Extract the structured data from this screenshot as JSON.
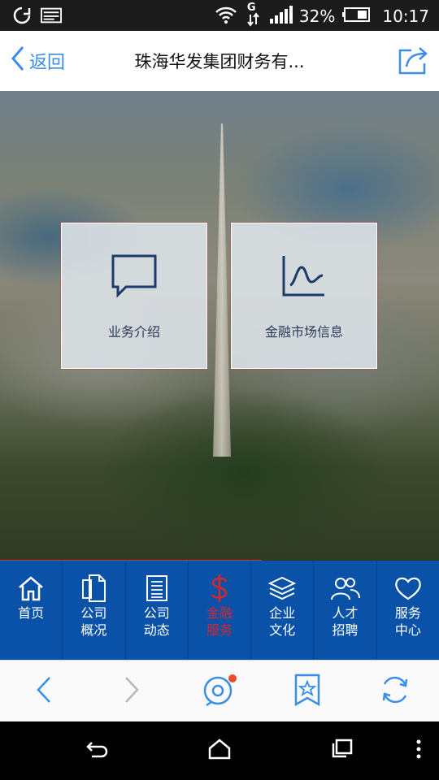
{
  "status_bar": {
    "battery_percent": "32%",
    "time": "10:17",
    "network_badge": "G",
    "icons": [
      "sync-icon",
      "photo-icon",
      "wifi-icon",
      "data-icon",
      "signal-icon",
      "battery-icon"
    ]
  },
  "navbar": {
    "back_label": "返回",
    "title": "珠海华发集团财务有...",
    "share_icon": "share-icon"
  },
  "tiles": [
    {
      "label": "业务介绍",
      "icon": "chat-bubble-icon"
    },
    {
      "label": "金融市场信息",
      "icon": "market-chart-icon"
    }
  ],
  "bottom_nav": [
    {
      "line1": "首页",
      "line2": "",
      "icon": "home-icon",
      "active": false
    },
    {
      "line1": "公司",
      "line2": "概况",
      "icon": "documents-icon",
      "active": false
    },
    {
      "line1": "公司",
      "line2": "动态",
      "icon": "news-icon",
      "active": false
    },
    {
      "line1": "金融",
      "line2": "服务",
      "icon": "dollar-icon",
      "active": true
    },
    {
      "line1": "企业",
      "line2": "文化",
      "icon": "layers-icon",
      "active": false
    },
    {
      "line1": "人才",
      "line2": "招聘",
      "icon": "people-icon",
      "active": false
    },
    {
      "line1": "服务",
      "line2": "中心",
      "icon": "heart-icon",
      "active": false
    }
  ],
  "browser_toolbar": [
    "back-arrow-icon",
    "forward-arrow-icon",
    "chat-icon",
    "bookmark-star-icon",
    "refresh-icon"
  ],
  "colors": {
    "accent_blue": "#3a8ee6",
    "bottom_nav_bg": "#0a52a8",
    "active_red": "#d7262e"
  }
}
